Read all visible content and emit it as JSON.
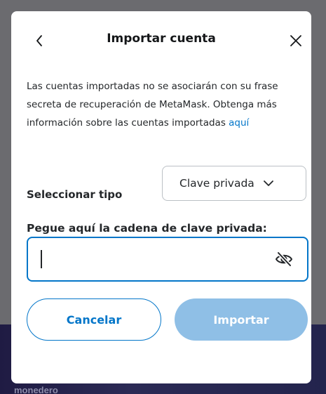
{
  "background": {
    "footer_text": "monedero"
  },
  "modal": {
    "title": "Importar cuenta",
    "description_text": "Las cuentas importadas no se asociarán con su frase secreta de recuperación de MetaMask. Obtenga más información sobre las cuentas importadas ",
    "description_link": "aquí",
    "select_type_label": "Seleccionar tipo",
    "select_type_value": "Clave privada",
    "private_key_label": "Pegue aquí la cadena de clave privada:",
    "private_key_value": "",
    "cancel_label": "Cancelar",
    "import_label": "Importar"
  },
  "icons": {
    "back": "chevron-left-icon",
    "close": "close-icon",
    "dropdown": "chevron-down-icon",
    "visibility": "eye-slash-icon"
  },
  "colors": {
    "primary": "#0376c9",
    "primary_disabled": "#8fbfe6",
    "text": "#24272a",
    "border": "#bbc0c5"
  }
}
